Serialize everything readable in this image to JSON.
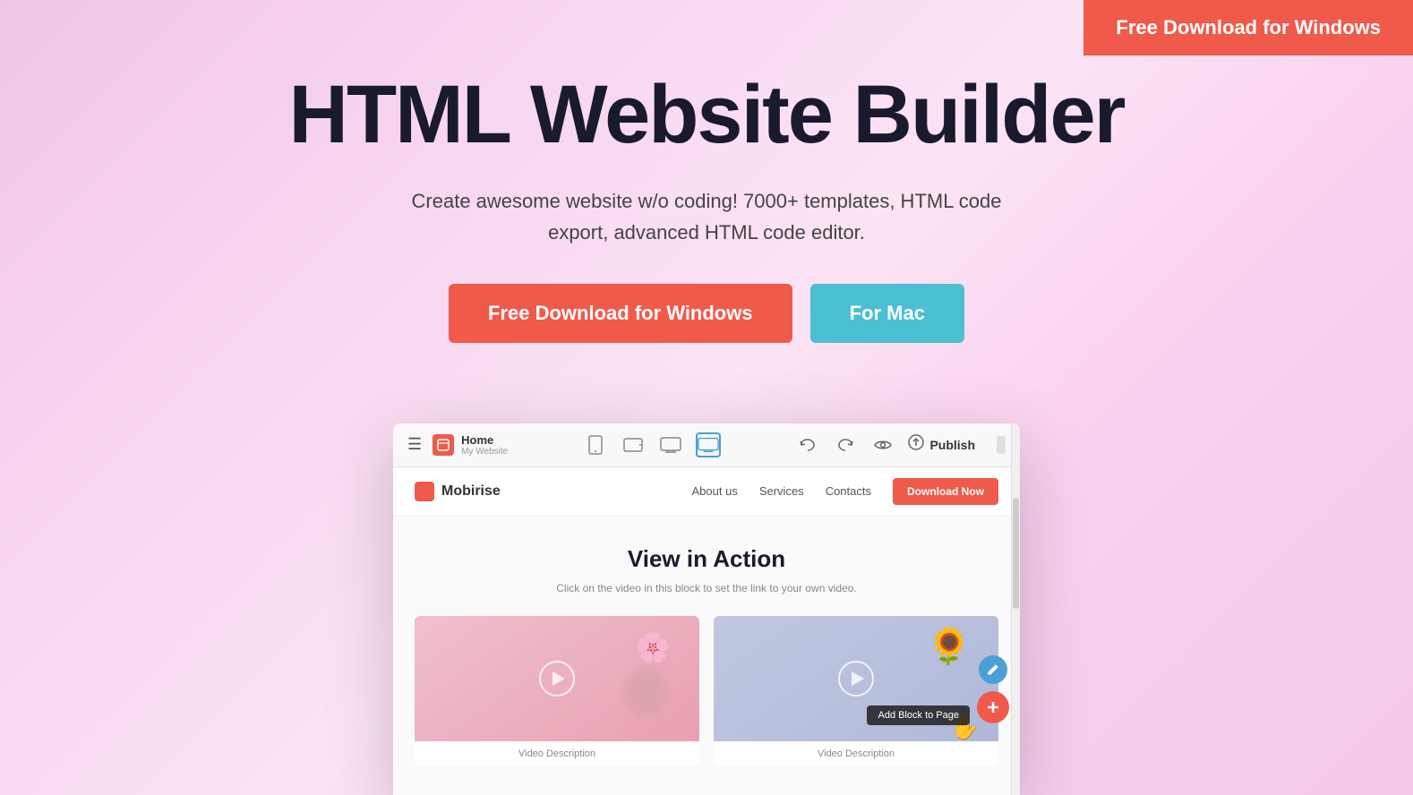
{
  "topCta": {
    "label": "Free Download for Windows"
  },
  "hero": {
    "title": "HTML Website Builder",
    "subtitle": "Create awesome website w/o coding! 7000+ templates, HTML code export, advanced HTML code editor.",
    "btnWindows": "Free Download for Windows",
    "btnMac": "For Mac"
  },
  "appPreview": {
    "toolbar": {
      "hamburgerLabel": "☰",
      "homeLabel": "Home",
      "homeSubLabel": "My Website",
      "iconPhone": "📱",
      "iconTablet": "▭",
      "iconDesktopSmall": "▭",
      "iconDesktopActive": "🖥",
      "iconBack": "←",
      "iconForward": "→",
      "iconEye": "👁",
      "publishLabel": "Publish"
    },
    "siteNavbar": {
      "logoLabel": "Mobirise",
      "links": [
        "About us",
        "Services",
        "Contacts"
      ],
      "ctaBtn": "Download Now"
    },
    "siteContent": {
      "title": "View in Action",
      "subtitle": "Click on the video in this block to set the link to your own video.",
      "video1Description": "Video Description",
      "video2Description": "Video Description",
      "addBlockLabel": "Add Block to Page"
    }
  },
  "colors": {
    "primary": "#f05a4b",
    "secondary": "#4bbfd4",
    "accent": "#4a9fd4",
    "dark": "#1a1a2e"
  }
}
